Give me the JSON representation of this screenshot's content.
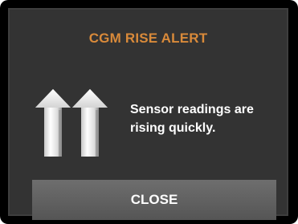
{
  "alert": {
    "title": "CGM RISE ALERT",
    "message": "Sensor readings are rising quickly.",
    "icon": "double-up-arrow-icon",
    "close_label": "CLOSE"
  },
  "colors": {
    "title": "#d98a3a",
    "screen_background": "#333333",
    "bezel": "#000000",
    "button": "#5f5f5f",
    "text": "#ffffff"
  }
}
